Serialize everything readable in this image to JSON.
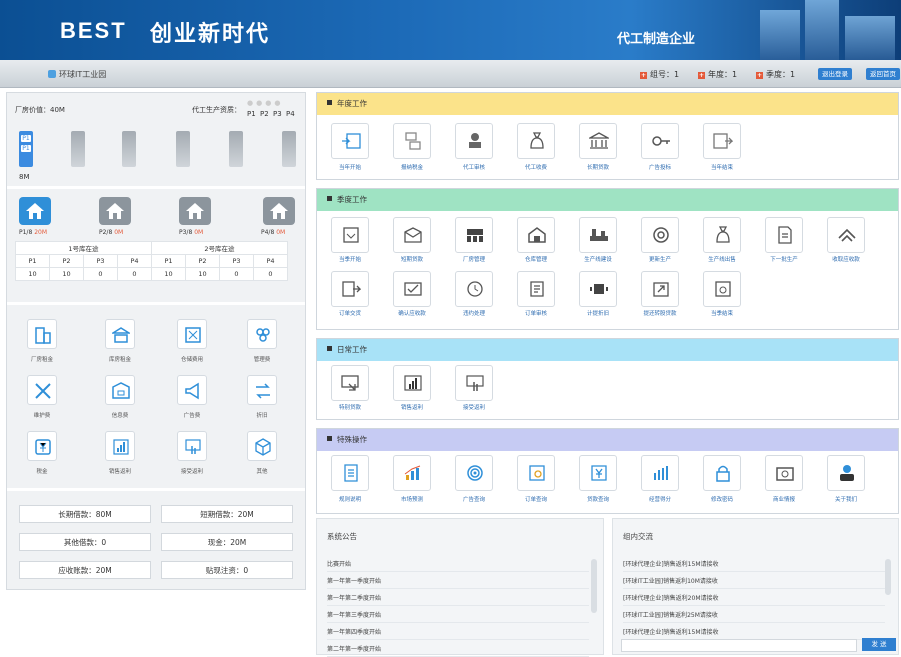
{
  "header": {
    "title": "BEST",
    "slogan": "创业新时代",
    "company": "代工制造企业"
  },
  "statusbar": {
    "company": "环球IT工业园",
    "group_label": "组号：1",
    "year_label": "年度：1",
    "quarter_label": "季度：1",
    "logout": "退出登录",
    "home": "返回首页"
  },
  "factory": {
    "value_label": "厂房价值：40M",
    "lines_label": "代工生产资质：",
    "lines": [
      "P1",
      "P2",
      "P3",
      "P4"
    ],
    "products": [
      "P1",
      "P1"
    ],
    "cash": "8M"
  },
  "houses": [
    {
      "label": "P1/8",
      "val": "20M"
    },
    {
      "label": "P2/8",
      "val": "0M"
    },
    {
      "label": "P3/8",
      "val": "0M"
    },
    {
      "label": "P4/8",
      "val": "0M"
    }
  ],
  "pipeline": {
    "left_title": "1号库在途",
    "right_title": "2号库在途",
    "headers": [
      "P1",
      "P2",
      "P3",
      "P4",
      "P1",
      "P2",
      "P3",
      "P4"
    ],
    "values": [
      "10",
      "10",
      "0",
      "0",
      "10",
      "10",
      "0",
      "0"
    ]
  },
  "finance": [
    {
      "label": "厂房租金",
      "icon": "building-icon"
    },
    {
      "label": "库房租金",
      "icon": "bank-icon"
    },
    {
      "label": "仓储费用",
      "icon": "box-icon"
    },
    {
      "label": "管理费",
      "icon": "people-icon"
    },
    {
      "label": "维护费",
      "icon": "tools-icon"
    },
    {
      "label": "信息费",
      "icon": "folder-icon"
    },
    {
      "label": "广告费",
      "icon": "megaphone-icon"
    },
    {
      "label": "折旧",
      "icon": "exchange-icon"
    },
    {
      "label": "税金",
      "icon": "tax-icon"
    },
    {
      "label": "销售返利",
      "icon": "chart-icon"
    },
    {
      "label": "接受返利",
      "icon": "hand-icon"
    },
    {
      "label": "其他",
      "icon": "cube-icon"
    }
  ],
  "money": {
    "long_loan": "长期借款：80M",
    "short_loan": "短期借款：20M",
    "other_loan": "其他借款：0",
    "cash": "现金：20M",
    "receivable": "应收账款：20M",
    "discount": "贴现注资：0"
  },
  "year_panel": {
    "title": "年度工作",
    "items": [
      "当年开始",
      "报纳税金",
      "代工审核",
      "代工收费",
      "长期贷款",
      "广告投标",
      "当年结束"
    ]
  },
  "quarter_panel": {
    "title": "季度工作",
    "items_row1": [
      "当季开始",
      "短期贷款",
      "厂房管理",
      "仓库管理",
      "生产线建设",
      "更新生产",
      "生产线出售",
      "下一批生产",
      "收取应收款"
    ],
    "items_row2": [
      "订单交货",
      "确认应收款",
      "违约处理",
      "订单审核",
      "计提折旧",
      "提还转股贷款",
      "当季结束"
    ]
  },
  "daily_panel": {
    "title": "日常工作",
    "items": [
      "特别贷款",
      "销售返利",
      "接受返利"
    ]
  },
  "special_panel": {
    "title": "特殊操作",
    "items": [
      "规则说明",
      "市场预测",
      "广告查询",
      "订单查询",
      "贷款查询",
      "经营得分",
      "修改密码",
      "商业情报",
      "关于我们"
    ]
  },
  "notice": {
    "title": "系统公告",
    "rows": [
      "比赛开始",
      "第一年第一季度开始",
      "第一年第二季度开始",
      "第一年第三季度开始",
      "第一年第四季度开始",
      "第二年第一季度开始"
    ]
  },
  "chat": {
    "title": "组内交流",
    "rows": [
      "[环球代理企业]销售返利15M请接收",
      "[环球IT工业园]销售返利10M请接收",
      "[环球代理企业]销售返利20M请接收",
      "[环球IT工业园]销售返利25M请接收",
      "[环球代理企业]销售返利15M请接收"
    ],
    "send": "发 送"
  }
}
